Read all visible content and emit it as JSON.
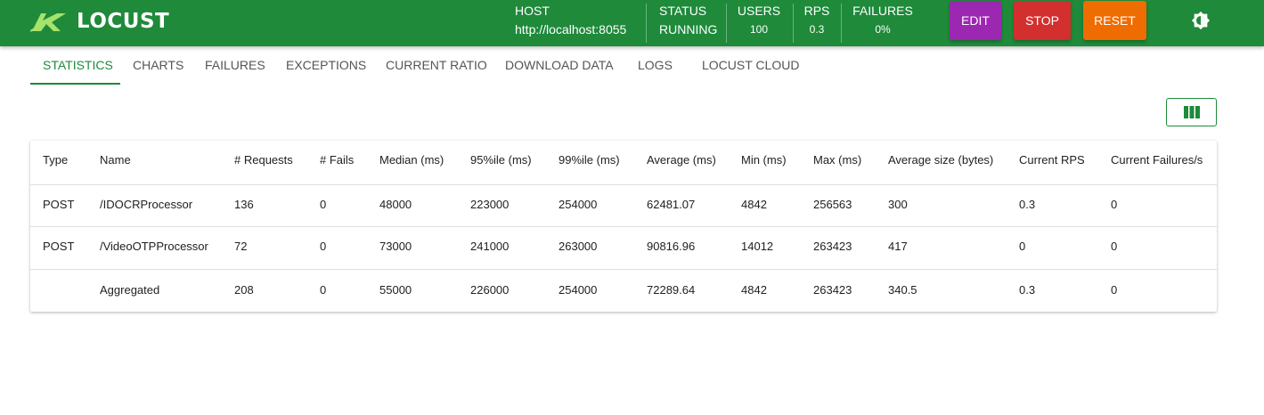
{
  "app": {
    "logo_text": "LOCUST"
  },
  "header": {
    "host": {
      "label": "HOST",
      "value": "http://localhost:8055"
    },
    "status": {
      "label": "STATUS",
      "value": "RUNNING"
    },
    "users": {
      "label": "USERS",
      "value": "100"
    },
    "rps": {
      "label": "RPS",
      "value": "0.3"
    },
    "failures": {
      "label": "FAILURES",
      "value": "0%"
    },
    "buttons": {
      "edit": "EDIT",
      "stop": "STOP",
      "reset": "RESET"
    },
    "colors": {
      "bar": "#1e8a3a",
      "edit": "#9c27b0",
      "stop": "#d32f2f",
      "reset": "#ef6c00"
    }
  },
  "tabs": [
    "STATISTICS",
    "CHARTS",
    "FAILURES",
    "EXCEPTIONS",
    "CURRENT RATIO",
    "DOWNLOAD DATA",
    "LOGS",
    "LOCUST CLOUD"
  ],
  "active_tab": "STATISTICS",
  "table": {
    "columns": [
      "Type",
      "Name",
      "# Requests",
      "# Fails",
      "Median (ms)",
      "95%ile (ms)",
      "99%ile (ms)",
      "Average (ms)",
      "Min (ms)",
      "Max (ms)",
      "Average size (bytes)",
      "Current RPS",
      "Current Failures/s"
    ],
    "rows": [
      [
        "POST",
        "/IDOCRProcessor",
        "136",
        "0",
        "48000",
        "223000",
        "254000",
        "62481.07",
        "4842",
        "256563",
        "300",
        "0.3",
        "0"
      ],
      [
        "POST",
        "/VideoOTPProcessor",
        "72",
        "0",
        "73000",
        "241000",
        "263000",
        "90816.96",
        "14012",
        "263423",
        "417",
        "0",
        "0"
      ],
      [
        "",
        "Aggregated",
        "208",
        "0",
        "55000",
        "226000",
        "254000",
        "72289.64",
        "4842",
        "263423",
        "340.5",
        "0.3",
        "0"
      ]
    ]
  }
}
